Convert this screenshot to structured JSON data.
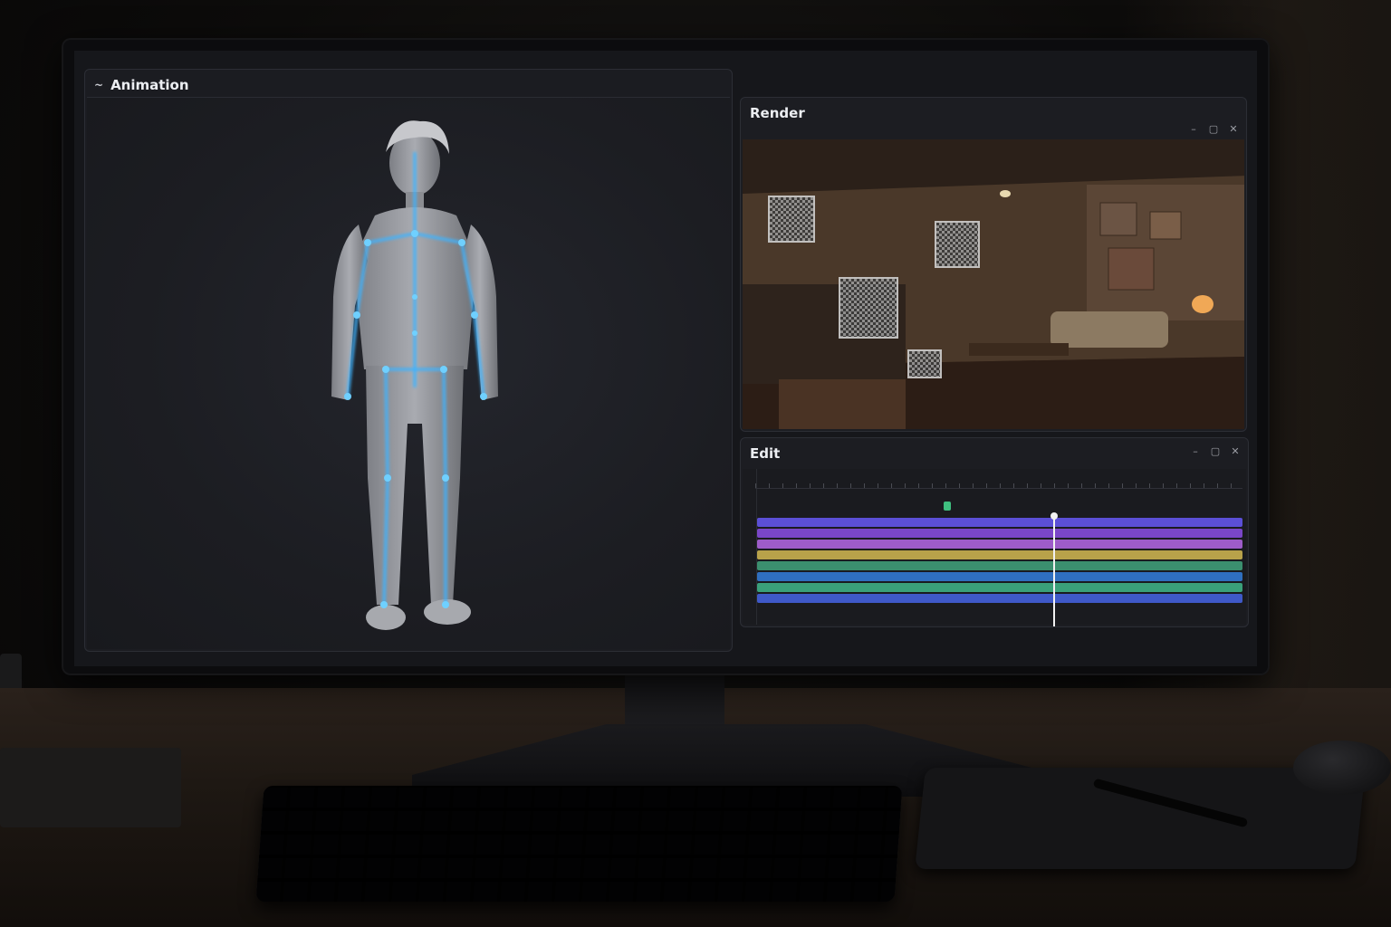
{
  "animation_window": {
    "title": "Animation",
    "menu_icon": "menu-dash-icon",
    "controls": [
      "minimize-icon",
      "maximize-icon",
      "close-icon"
    ],
    "control_glyphs": [
      "–",
      "▢",
      "✕"
    ]
  },
  "render_window": {
    "title": "Render",
    "controls": [
      "minimize-icon",
      "maximize-icon",
      "close-icon"
    ],
    "control_glyphs": [
      "–",
      "▢",
      "✕"
    ]
  },
  "edit_window": {
    "title": "Edit",
    "controls": [
      "minimize-icon",
      "maximize-icon",
      "close-icon"
    ],
    "control_glyphs": [
      "–",
      "▢",
      "✕"
    ],
    "tracks": [
      {
        "color": "#5b4fd6"
      },
      {
        "color": "#7a46c8"
      },
      {
        "color": "#9d5cc9"
      },
      {
        "color": "#b8a24a"
      },
      {
        "color": "#3b8f6f"
      },
      {
        "color": "#2f6fbf"
      },
      {
        "color": "#3aa07a"
      },
      {
        "color": "#3f59c8"
      }
    ]
  },
  "colors": {
    "rig_bones": "#3db3ff",
    "accent_green": "#3fbf7f",
    "playhead": "#f2f2f2"
  }
}
